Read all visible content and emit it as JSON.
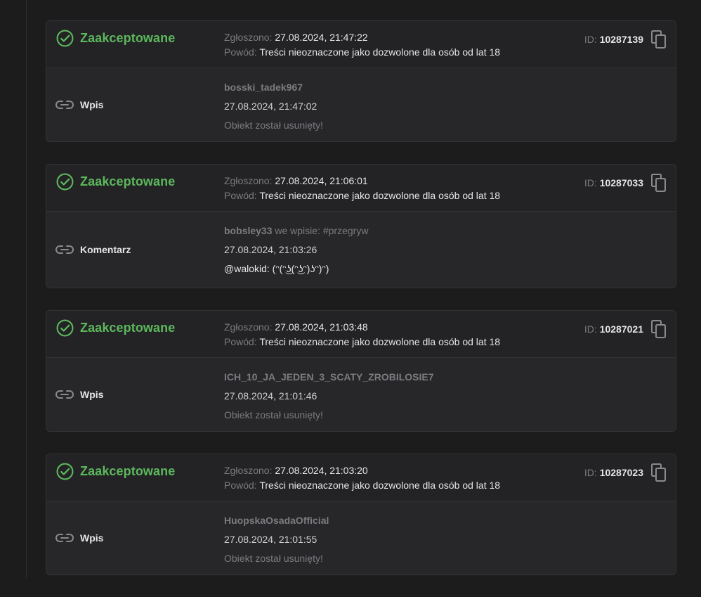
{
  "labels": {
    "reported_prefix": "Zgłoszono:",
    "reason_prefix": "Powód:",
    "id_prefix": "ID:"
  },
  "colors": {
    "accepted": "#5cb85c",
    "background": "#1c1c1d",
    "card": "#27272a"
  },
  "reports": [
    {
      "status": "Zaakceptowane",
      "reported_at": "27.08.2024, 21:47:22",
      "reason": "Treści nieoznaczone jako dozwolone dla osób od lat 18",
      "id": "10287139",
      "type": "Wpis",
      "author": "bosski_tadek967",
      "author_context": "",
      "date": "27.08.2024, 21:47:02",
      "content": "Obiekt został usunięty!"
    },
    {
      "status": "Zaakceptowane",
      "reported_at": "27.08.2024, 21:06:01",
      "reason": "Treści nieoznaczone jako dozwolone dla osób od lat 18",
      "id": "10287033",
      "type": "Komentarz",
      "author": "bobsley33",
      "author_context": "we wpisie: #przegryw",
      "date": "27.08.2024, 21:03:26",
      "content": "@walokid: (ᵔ(ᵔ͜ʖ(ᵔ͜ʖᵔ)ʖᵔ)ᵔ)"
    },
    {
      "status": "Zaakceptowane",
      "reported_at": "27.08.2024, 21:03:48",
      "reason": "Treści nieoznaczone jako dozwolone dla osób od lat 18",
      "id": "10287021",
      "type": "Wpis",
      "author": "ICH_10_JA_JEDEN_3_SCATY_ZROBILOSIE7",
      "author_context": "",
      "date": "27.08.2024, 21:01:46",
      "content": "Obiekt został usunięty!"
    },
    {
      "status": "Zaakceptowane",
      "reported_at": "27.08.2024, 21:03:20",
      "reason": "Treści nieoznaczone jako dozwolone dla osób od lat 18",
      "id": "10287023",
      "type": "Wpis",
      "author": "HuopskaOsadaOfficial",
      "author_context": "",
      "date": "27.08.2024, 21:01:55",
      "content": "Obiekt został usunięty!"
    }
  ]
}
